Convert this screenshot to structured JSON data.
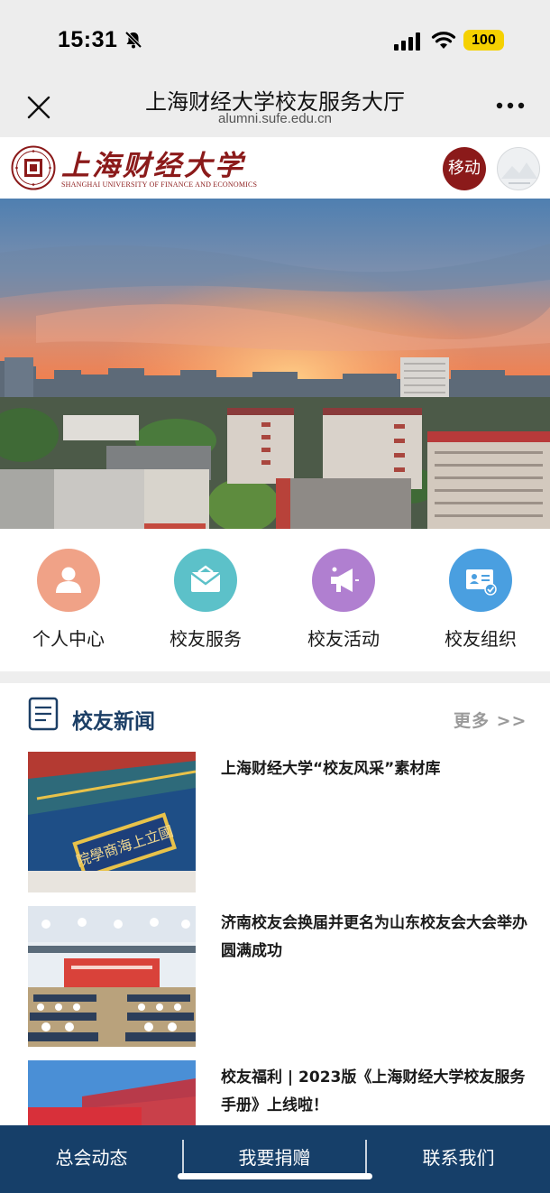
{
  "status_bar": {
    "time": "15:31",
    "battery": "100",
    "battery_color": "#f5d100"
  },
  "nav_bar": {
    "title": "上海财经大学校友服务大厅",
    "url": "alumni.sufe.edu.cn"
  },
  "header": {
    "logo_name": "上海财经大学",
    "logo_subtitle": "SHANGHAI UNIVERSITY OF FINANCE AND ECONOMICS",
    "mobile_label": "移动",
    "brand_color": "#8b1a1a"
  },
  "quick_menu": {
    "items": [
      {
        "label": "个人中心",
        "icon": "person-icon",
        "color": "#f0a287"
      },
      {
        "label": "校友服务",
        "icon": "envelope-icon",
        "color": "#5cc1c9"
      },
      {
        "label": "校友活动",
        "icon": "megaphone-icon",
        "color": "#b07fd0"
      },
      {
        "label": "校友组织",
        "icon": "id-card-icon",
        "color": "#4a9fe0"
      }
    ]
  },
  "news": {
    "title": "校友新闻",
    "more": "更多 >>",
    "items": [
      {
        "title": "上海财经大学“校友风采”素材库",
        "thumb": "campus-gate-image"
      },
      {
        "title": "济南校友会换届并更名为山东校友会大会举办圆满成功",
        "thumb": "conference-hall-image"
      },
      {
        "title": "校友福利 | 2023版《上海财经大学校友服务手册》上线啦！",
        "thumb": "red-building-image"
      }
    ]
  },
  "bottom_nav": {
    "items": [
      "总会动态",
      "我要捐赠",
      "联系我们"
    ],
    "background": "#163f69"
  }
}
